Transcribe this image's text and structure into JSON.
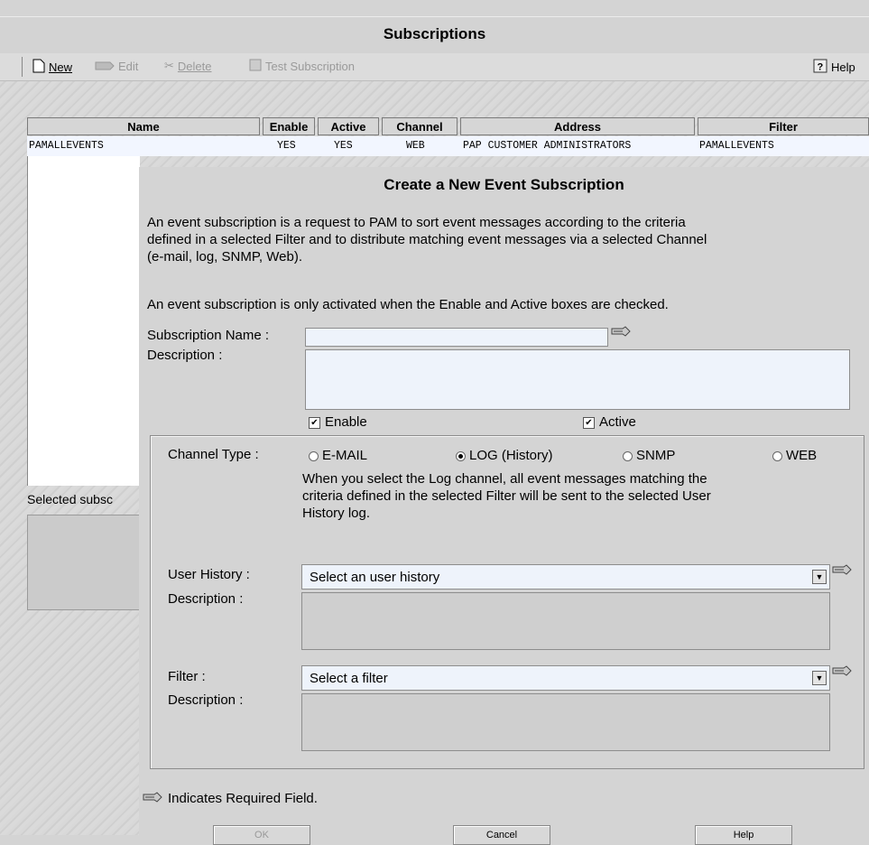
{
  "window": {
    "title": "Subscriptions"
  },
  "toolbar": {
    "new": "New",
    "edit": "Edit",
    "delete": "Delete",
    "test_subscription": "Test Subscription",
    "help": "Help"
  },
  "table": {
    "columns": [
      "Name",
      "Enable",
      "Active",
      "Channel",
      "Address",
      "Filter"
    ],
    "rows": [
      {
        "name": "PAMALLEVENTS",
        "enable": "YES",
        "active": "YES",
        "channel": "WEB",
        "address": "PAP CUSTOMER ADMINISTRATORS",
        "filter": "PAMALLEVENTS"
      }
    ],
    "selected_label": "Selected subsc"
  },
  "dialog": {
    "title": "Create a New Event Subscription",
    "intro_line1": "An event subscription is a request to PAM to sort event messages according to the criteria",
    "intro_line2": "defined in a selected Filter and to distribute matching event messages via a selected Channel",
    "intro_line3": "(e-mail, log, SNMP, Web).",
    "activation_note": "An event subscription is only activated when the Enable and Active boxes are checked.",
    "subscription_name_label": "Subscription Name :",
    "subscription_name_value": "",
    "description_label": "Description :",
    "description_value": "",
    "enable_label": "Enable",
    "enable_checked": true,
    "active_label": "Active",
    "active_checked": true,
    "channel_type_label": "Channel Type :",
    "channels": [
      "E-MAIL",
      "LOG (History)",
      "SNMP",
      "WEB"
    ],
    "selected_channel": "LOG (History)",
    "log_note_line1": "When you select the Log channel, all event messages matching the",
    "log_note_line2": "criteria defined in the selected Filter will be sent to the selected User",
    "log_note_line3": "History log.",
    "user_history_label": "User History :",
    "user_history_value": "Select an user history",
    "user_history_desc_label": "Description :",
    "filter_label": "Filter :",
    "filter_value": "Select a filter",
    "filter_desc_label": "Description :",
    "required_note": "Indicates Required Field.",
    "ok_label": "OK",
    "cancel_label": "Cancel",
    "help_label": "Help"
  },
  "colors": {
    "input_bg": "#eef3fb",
    "row_highlight": "#f2f6ff"
  },
  "icons": [
    "new-document-icon",
    "edit-icon",
    "delete-scissors-icon",
    "test-icon",
    "help-icon",
    "required-field-icon",
    "dropdown-arrow-icon"
  ]
}
